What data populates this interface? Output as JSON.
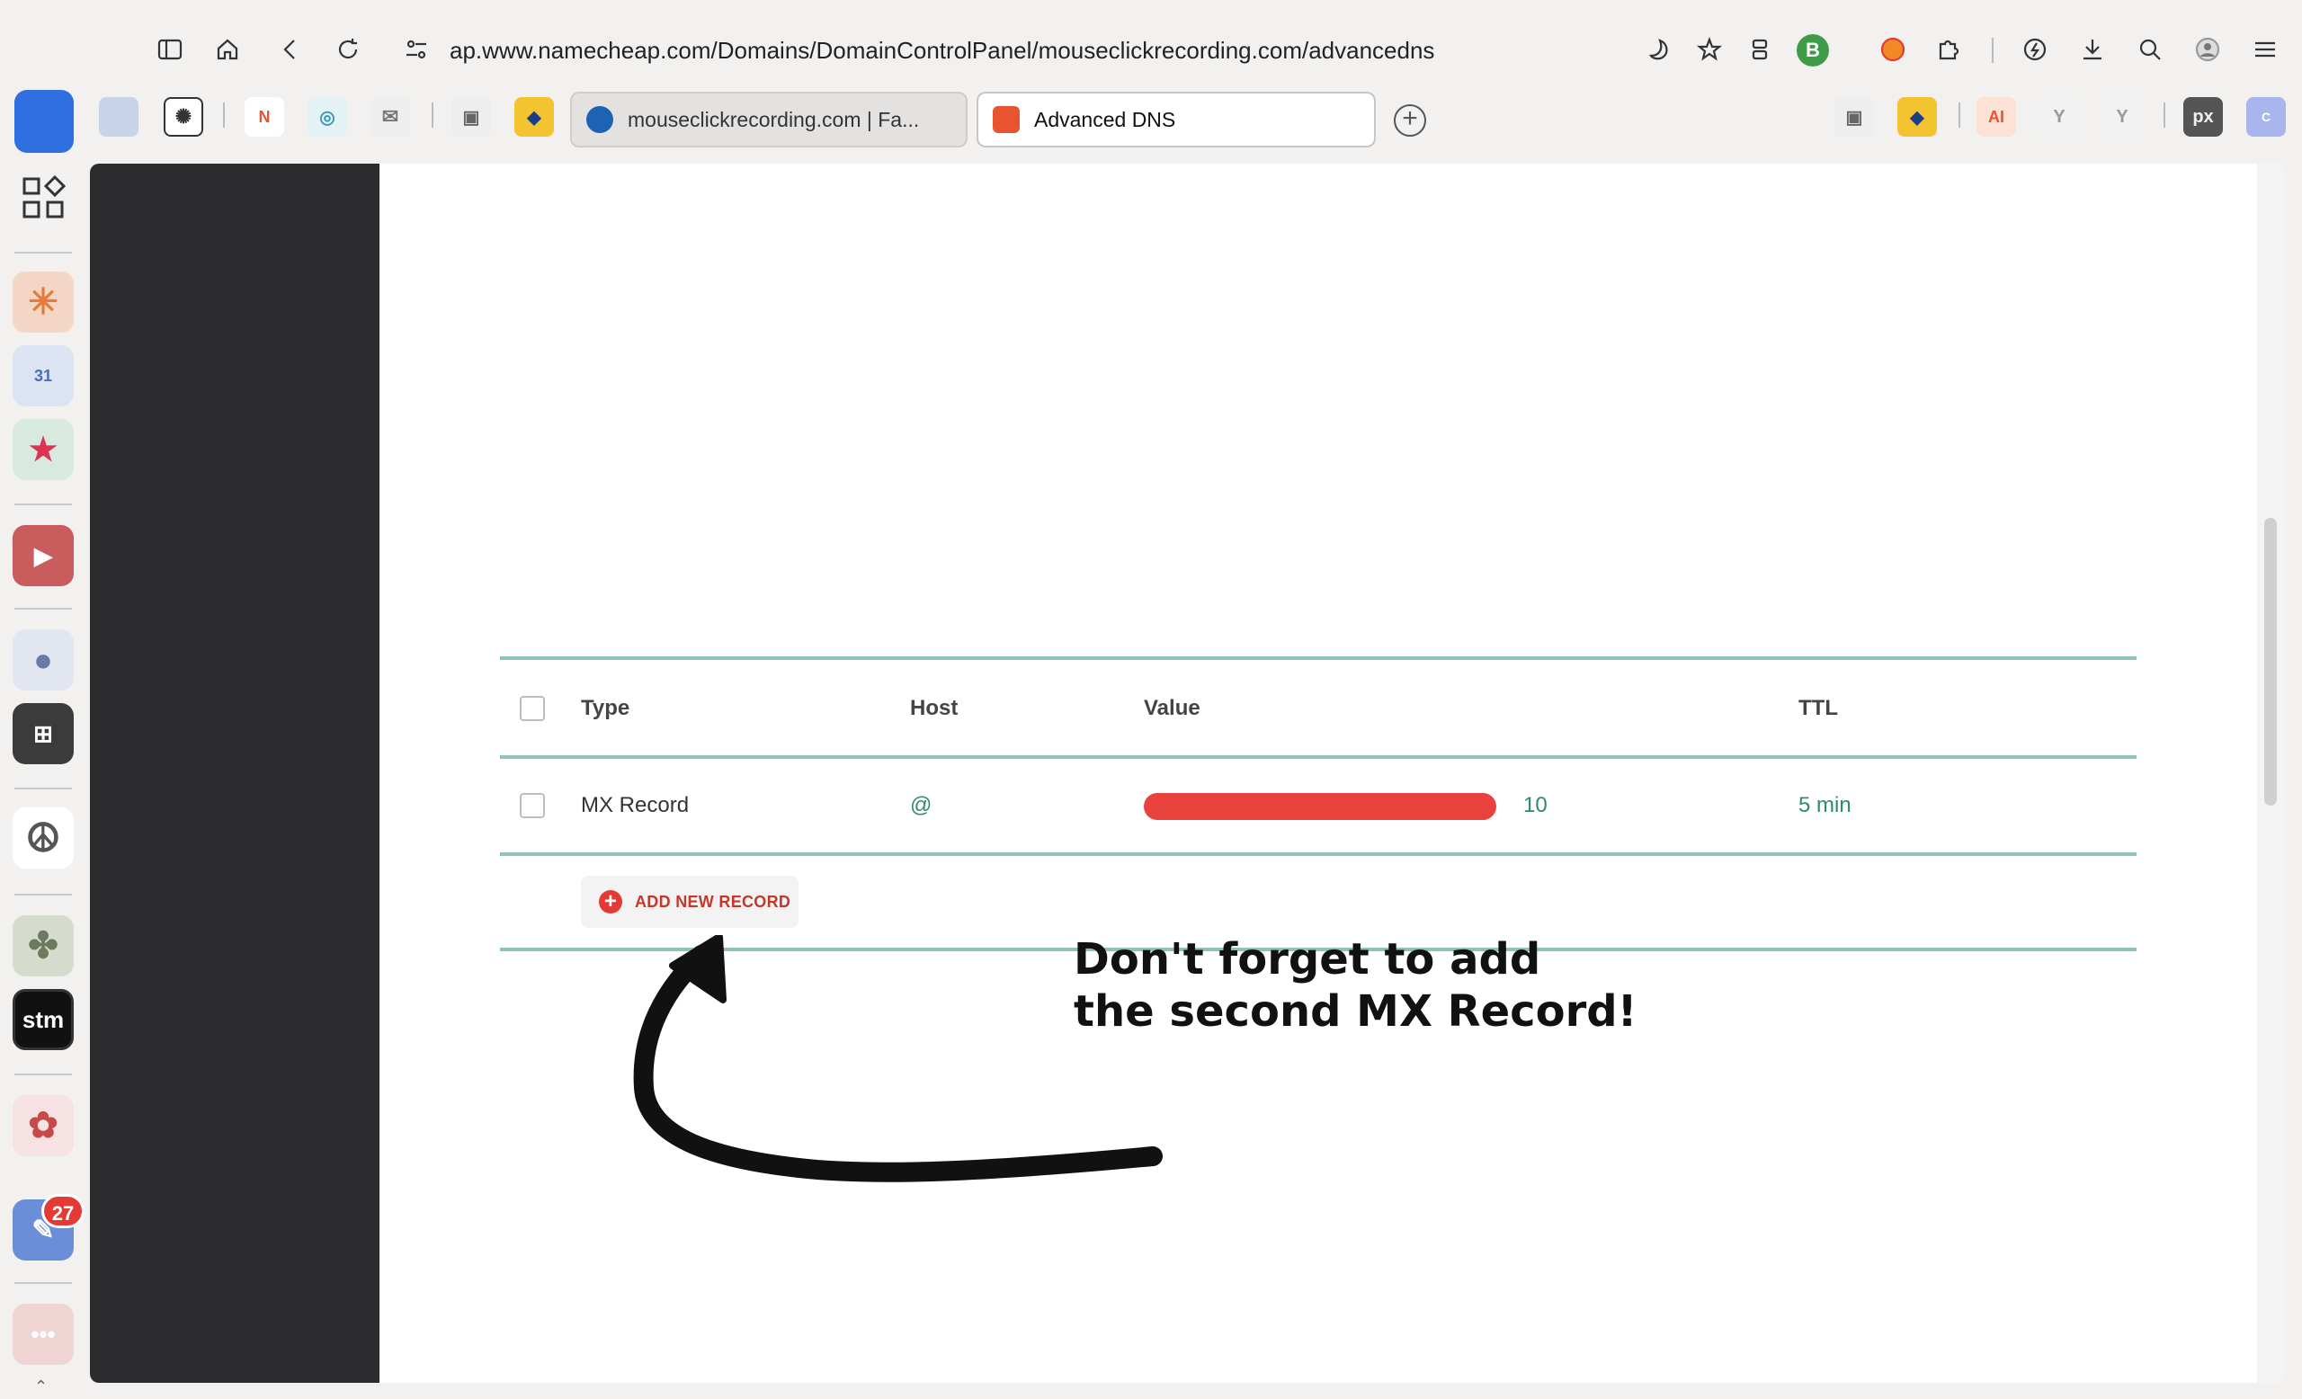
{
  "browser": {
    "url": "ap.www.namecheap.com/Domains/DomainControlPanel/mouseclickrecording.com/advancedns",
    "profile_initial": "B",
    "tabs": [
      {
        "label": "mouseclickrecording.com | Fa...",
        "favicon_color": "#1e62b4",
        "active": false
      },
      {
        "label": "Advanced DNS",
        "favicon_color": "#e8542f",
        "active": true
      }
    ]
  },
  "dock": {
    "badge_count": "27",
    "stm_label": "stm"
  },
  "dns_table": {
    "headers": {
      "type": "Type",
      "host": "Host",
      "value": "Value",
      "ttl": "TTL"
    },
    "rows": [
      {
        "type": "MX Record",
        "host": "@",
        "priority": "10",
        "ttl": "5 min"
      }
    ],
    "add_button_label": "ADD NEW RECORD"
  },
  "annotation": {
    "line1": "Don't forget to add",
    "line2": "the second MX Record!"
  },
  "colors": {
    "accent_red": "#e53935",
    "table_line": "#8fc2bb",
    "host_green": "#2e8a6c"
  }
}
